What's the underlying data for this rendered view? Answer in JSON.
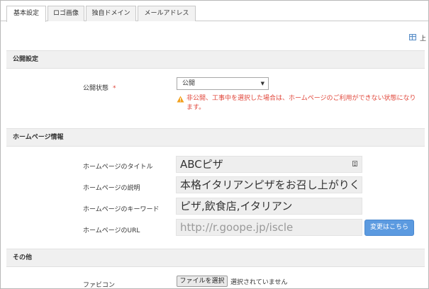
{
  "tabs": [
    {
      "label": "基本設定",
      "active": true
    },
    {
      "label": "ロゴ画像",
      "active": false
    },
    {
      "label": "独自ドメイン",
      "active": false
    },
    {
      "label": "メールアドレス",
      "active": false
    }
  ],
  "toolbar": {
    "label": "上",
    "icon": "table-icon"
  },
  "sections": {
    "publish": {
      "title": "公開設定"
    },
    "homepage": {
      "title": "ホームページ情報"
    },
    "other": {
      "title": "その他"
    }
  },
  "publish": {
    "status_label": "公開状態",
    "required_mark": "*",
    "status_value": "公開",
    "warning": "非公開、工事中を選択した場合は、ホームページのご利用ができない状態になります。"
  },
  "homepage": {
    "title_label": "ホームページのタイトル",
    "title_value": "ABCピザ",
    "description_label": "ホームページの説明",
    "description_value": "本格イタリアンピザをお召し上がりく",
    "keywords_label": "ホームページのキーワード",
    "keywords_value": "ピザ,飲食店,イタリアン",
    "url_label": "ホームページのURL",
    "url_value": "http://r.goope.jp/iscle",
    "change_button": "変更はこちら"
  },
  "other": {
    "favicon_label": "ファビコン",
    "file_button": "ファイルを選択",
    "file_status": "選択されていません"
  },
  "colors": {
    "accent": "#5b9ae0",
    "warning": "#e0463a",
    "section_bg": "#f0f0f0"
  }
}
